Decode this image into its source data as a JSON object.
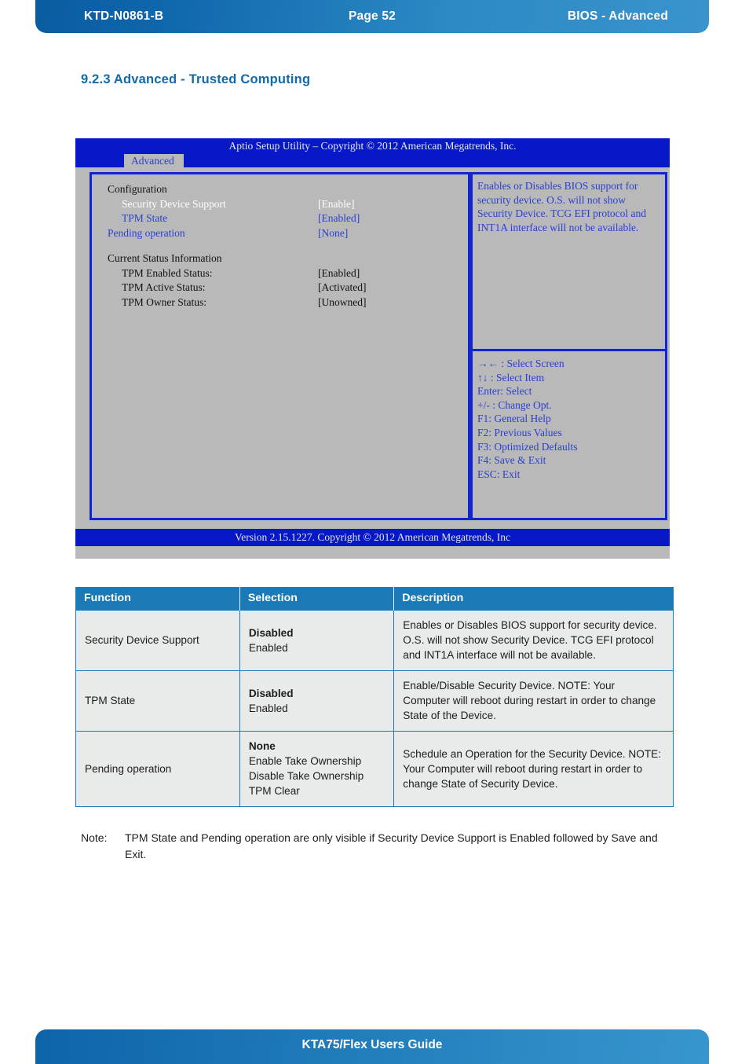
{
  "header": {
    "doc_id": "KTD-N0861-B",
    "page": "Page 52",
    "section": "BIOS  - Advanced"
  },
  "heading": "9.2.3  Advanced  -  Trusted Computing",
  "bios": {
    "title": "Aptio Setup Utility  –  Copyright © 2012 American Megatrends, Inc.",
    "tab": "Advanced",
    "config_heading": "Configuration",
    "config_items": [
      {
        "label": "Security Device Support",
        "value": "[Enable]"
      },
      {
        "label": "TPM State",
        "value": "[Enabled]"
      },
      {
        "label": "Pending operation",
        "value": "[None]"
      }
    ],
    "status_heading": "Current Status Information",
    "status_items": [
      {
        "label": "TPM Enabled Status:",
        "value": "[Enabled]"
      },
      {
        "label": "TPM Active Status:",
        "value": "[Activated]"
      },
      {
        "label": "TPM Owner Status:",
        "value": "[Unowned]"
      }
    ],
    "help_text": "Enables or Disables BIOS support for security device. O.S. will not show Security Device. TCG EFI protocol and INT1A interface will not be available.",
    "keys": [
      "→←  : Select Screen",
      "↑↓ : Select Item",
      "Enter: Select",
      "+/- : Change Opt.",
      "F1: General Help",
      "F2: Previous Values",
      "F3: Optimized Defaults",
      "F4: Save & Exit",
      "ESC: Exit"
    ],
    "footer": "Version 2.15.1227. Copyright © 2012 American Megatrends, Inc"
  },
  "table": {
    "columns": [
      "Function",
      "Selection",
      "Description"
    ],
    "rows": [
      {
        "function": "Security Device Support",
        "selection_default": "Disabled",
        "selection_options": [
          "Enabled"
        ],
        "description": "Enables or Disables BIOS support for security device. O.S. will not show Security Device. TCG EFI protocol and INT1A interface will not be available."
      },
      {
        "function": "TPM State",
        "selection_default": "Disabled",
        "selection_options": [
          "Enabled"
        ],
        "description": "Enable/Disable Security Device. NOTE: Your Computer will reboot during restart in order to change State of the Device."
      },
      {
        "function": "Pending operation",
        "selection_default": "None",
        "selection_options": [
          "Enable Take Ownership",
          "Disable Take Ownership",
          "TPM Clear"
        ],
        "description": "Schedule an Operation for the Security Device. NOTE: Your Computer will reboot during restart in order to change State of Security Device."
      }
    ]
  },
  "note": {
    "label": "Note:",
    "text": "TPM State and Pending operation are only visible if Security Device Support is Enabled followed by Save and Exit."
  },
  "footer": {
    "title": "KTA75/Flex Users Guide"
  },
  "colors": {
    "brand_blue": "#1269ab",
    "table_header": "#1b7ab5",
    "bios_blue": "#0618c8",
    "bios_gray": "#b9b9b9",
    "bios_text_blue": "#2b3fd0"
  }
}
